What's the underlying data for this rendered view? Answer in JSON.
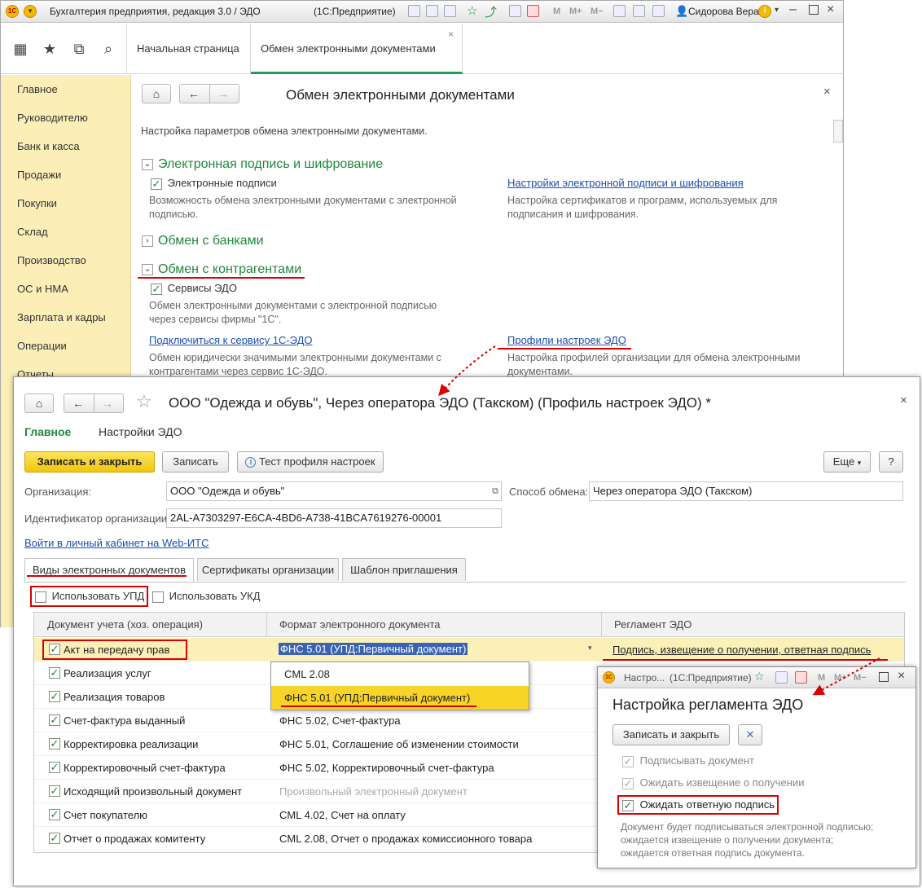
{
  "titlebar": {
    "app_title": "Бухгалтерия предприятия, редакция 3.0 / ЭДО",
    "platform": "(1С:Предприятие)",
    "m_buttons": [
      "M",
      "M+",
      "M−"
    ],
    "user": "Сидорова Вера"
  },
  "tabs": [
    {
      "label": "Начальная страница"
    },
    {
      "label": "Обмен электронными документами"
    }
  ],
  "sidebar": {
    "items": [
      "Главное",
      "Руководителю",
      "Банк и касса",
      "Продажи",
      "Покупки",
      "Склад",
      "Производство",
      "ОС и НМА",
      "Зарплата и кадры",
      "Операции",
      "Отчеты"
    ]
  },
  "edo_page": {
    "title": "Обмен электронными документами",
    "intro": "Настройка параметров обмена электронными документами.",
    "sign_section": {
      "title": "Электронная подпись и шифрование",
      "checkbox": "Электронные подписи",
      "desc_line1": "Возможность обмена электронными документами с электронной",
      "desc_line2": "подписью.",
      "link": "Настройки электронной подписи и шифрования",
      "link_desc_line1": "Настройка сертификатов и программ, используемых для",
      "link_desc_line2": "подписания и шифрования."
    },
    "banks_section": {
      "title": "Обмен с банками"
    },
    "contractors_section": {
      "title": "Обмен с контрагентами",
      "checkbox": "Сервисы ЭДО",
      "desc_line1": "Обмен электронными документами с электронной подписью",
      "desc_line2": "через сервисы фирмы \"1С\".",
      "connect_link": "Подключиться к сервису 1С-ЭДО",
      "connect_desc_line1": "Обмен юридически значимыми электронными документами с",
      "connect_desc_line2": "контрагентами через сервис 1С-ЭДО.",
      "profiles_link": "Профили настроек ЭДО",
      "profiles_desc_line1": "Настройка профилей организации для обмена электронными",
      "profiles_desc_line2": "документами."
    }
  },
  "profile": {
    "title": "ООО \"Одежда и обувь\", Через оператора ЭДО (Такском) (Профиль настроек ЭДО) *",
    "nav_main": "Главное",
    "nav_settings": "Настройки ЭДО",
    "btn_save_close": "Записать и закрыть",
    "btn_save": "Записать",
    "btn_test": "Тест профиля настроек",
    "btn_more": "Еще",
    "btn_help": "?",
    "org_label": "Организация:",
    "org_value": "ООО \"Одежда и обувь\"",
    "method_label": "Способ обмена:",
    "method_value": "Через оператора ЭДО (Такском)",
    "id_label": "Идентификатор организации:",
    "id_value": "2AL-A7303297-E6CA-4BD6-A738-41BCA7619276-00001",
    "cabinet_link": "Войти в личный кабинет на Web-ИТС",
    "tabs": [
      "Виды электронных документов",
      "Сертификаты организации",
      "Шаблон приглашения"
    ],
    "use_upd": "Использовать УПД",
    "use_ukd": "Использовать УКД",
    "columns": [
      "Документ учета (хоз. операция)",
      "Формат электронного документа",
      "Регламент ЭДО"
    ],
    "rows": [
      {
        "doc": "Акт на передачу прав",
        "format": "ФНС 5.01 (УПД:Первичный документ)",
        "reg": "Подпись, извещение о получении, ответная подпись"
      },
      {
        "doc": "Реализация услуг",
        "format": "",
        "reg": ""
      },
      {
        "doc": "Реализация товаров",
        "format": "",
        "reg": ""
      },
      {
        "doc": "Счет-фактура выданный",
        "format": "ФНС 5.02, Счет-фактура",
        "reg": ""
      },
      {
        "doc": "Корректировка реализации",
        "format": "ФНС 5.01, Соглашение об изменении стоимости",
        "reg": ""
      },
      {
        "doc": "Корректировочный счет-фактура",
        "format": "ФНС 5.02, Корректировочный счет-фактура",
        "reg": ""
      },
      {
        "doc": "Исходящий произвольный документ",
        "format": "Произвольный электронный документ",
        "reg": ""
      },
      {
        "doc": "Счет покупателю",
        "format": "CML 4.02, Счет на оплату",
        "reg": ""
      },
      {
        "doc": "Отчет о продажах комитенту",
        "format": "CML 2.08, Отчет о продажах комиссионного товара",
        "reg": ""
      }
    ],
    "dropdown_options": [
      "CML 2.08",
      "ФНС 5.01 (УПД:Первичный документ)"
    ]
  },
  "reglament": {
    "window_title": "Настро...",
    "platform": "(1С:Предприятие)",
    "heading": "Настройка регламента ЭДО",
    "btn_save_close": "Записать и закрыть",
    "chk_sign": "Подписывать документ",
    "chk_notice": "Ожидать извещение о получении",
    "chk_reply": "Ожидать ответную подпись",
    "desc_line1": "Документ будет подписываться электронной подписью;",
    "desc_line2": "ожидается извещение о получении документа;",
    "desc_line3": "ожидается ответная подпись документа."
  },
  "colors": {
    "accent_green": "#21873b",
    "highlight_red": "#d90000",
    "link_blue": "#1a4fb0",
    "sidebar_bg": "#fbeeb7",
    "primary_yellow": "#f2c60f"
  }
}
